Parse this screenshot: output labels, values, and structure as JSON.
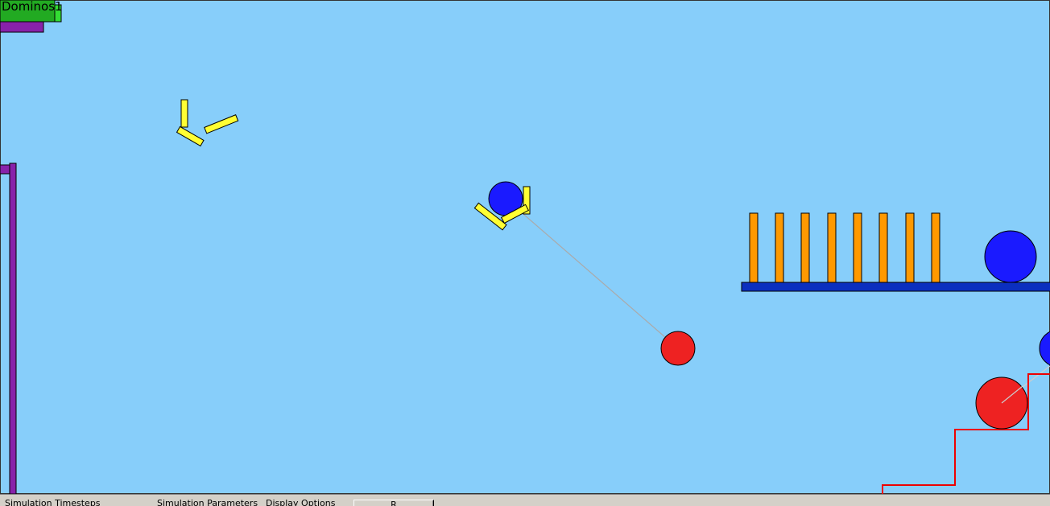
{
  "scene": {
    "title": "Dominos1",
    "background_color": "#87cefa",
    "colors": {
      "yellow": "#ffff33",
      "blue": "#1a1aff",
      "red": "#ee2222",
      "orange": "#ff9900",
      "green": "#22aa22",
      "purple": "#8822aa",
      "platform": "#0b2fbf",
      "rope": "#aaaaaa",
      "track": "#ee0000"
    }
  },
  "bottom_bar": {
    "items": [
      "Simulation Timesteps",
      "Simulation Parameters",
      "Display Options"
    ],
    "button_label": "R"
  }
}
